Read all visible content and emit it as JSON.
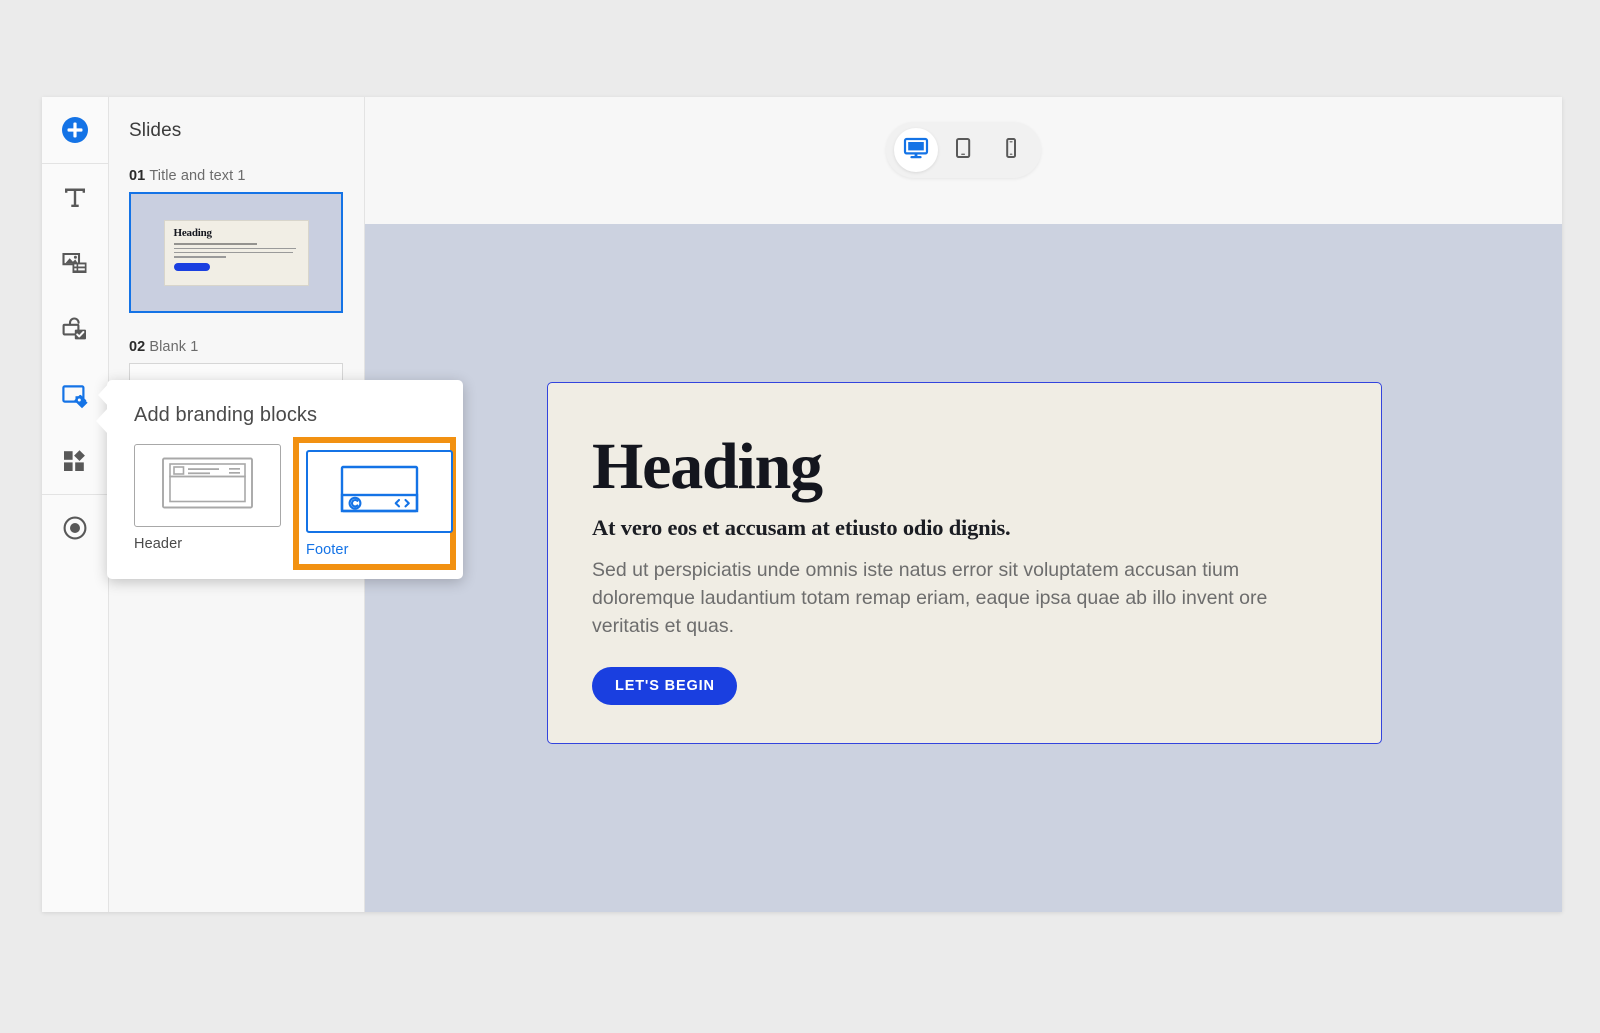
{
  "app": {
    "slides_panel_title": "Slides"
  },
  "icon_rail": {
    "items": [
      {
        "name": "add-button",
        "icon": "plus-circle-icon",
        "active": true,
        "label": "Add"
      },
      {
        "name": "text-tool",
        "icon": "text-icon",
        "active": false,
        "label": "Text"
      },
      {
        "name": "media-tool",
        "icon": "media-icon",
        "active": false,
        "label": "Media"
      },
      {
        "name": "interactive-tool",
        "icon": "interactive-icon",
        "active": false,
        "label": "Interactive"
      },
      {
        "name": "branding-tool",
        "icon": "branding-tag-icon",
        "active": true,
        "label": "Branding"
      },
      {
        "name": "components-tool",
        "icon": "components-icon",
        "active": false,
        "label": "Components"
      },
      {
        "name": "record-tool",
        "icon": "record-icon",
        "active": false,
        "label": "Record"
      }
    ]
  },
  "slides": [
    {
      "number": "01",
      "title": "Title and text 1",
      "selected": true
    },
    {
      "number": "02",
      "title": "Blank 1",
      "selected": false
    }
  ],
  "device_toggle": {
    "options": [
      {
        "name": "desktop",
        "icon": "desktop-icon",
        "active": true
      },
      {
        "name": "tablet",
        "icon": "tablet-icon",
        "active": false
      },
      {
        "name": "mobile",
        "icon": "mobile-icon",
        "active": false
      }
    ]
  },
  "slide_content": {
    "heading": "Heading",
    "subheading": "At vero eos et accusam at etiusto odio dignis.",
    "body": "Sed ut perspiciatis unde omnis iste natus error sit voluptatem accusan tium doloremque laudantium totam remap eriam, eaque ipsa quae ab illo invent ore veritatis et quas.",
    "cta_label": "LET'S BEGIN"
  },
  "popup": {
    "title": "Add branding blocks",
    "cards": [
      {
        "label": "Header",
        "icon": "header-block-icon",
        "selected": false
      },
      {
        "label": "Footer",
        "icon": "footer-block-icon",
        "selected": true
      }
    ]
  },
  "colors": {
    "accent_blue": "#1473e6",
    "cta_blue": "#1a3fe0",
    "highlight_orange": "#f29111",
    "canvas_blue_gray": "#ccd2e0",
    "slide_cream": "#f0ede4",
    "page_background": "#ebebeb"
  }
}
